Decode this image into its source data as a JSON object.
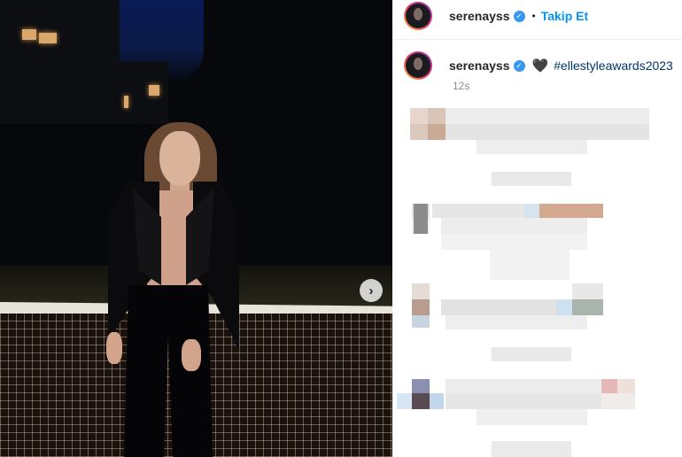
{
  "post": {
    "username": "serenayss",
    "follow_label": "Takip Et",
    "separator": "•",
    "caption_hashtag": "#ellestyleawards2023",
    "timestamp": "12s"
  },
  "icons": {
    "verified": "verified-badge-icon",
    "caption_emoji": "black-heart-icon",
    "next": "chevron-right-icon"
  },
  "colors": {
    "follow": "#0095f6",
    "hashtag": "#00376b",
    "verified": "#3897f0",
    "meta": "#8e8e8e"
  }
}
